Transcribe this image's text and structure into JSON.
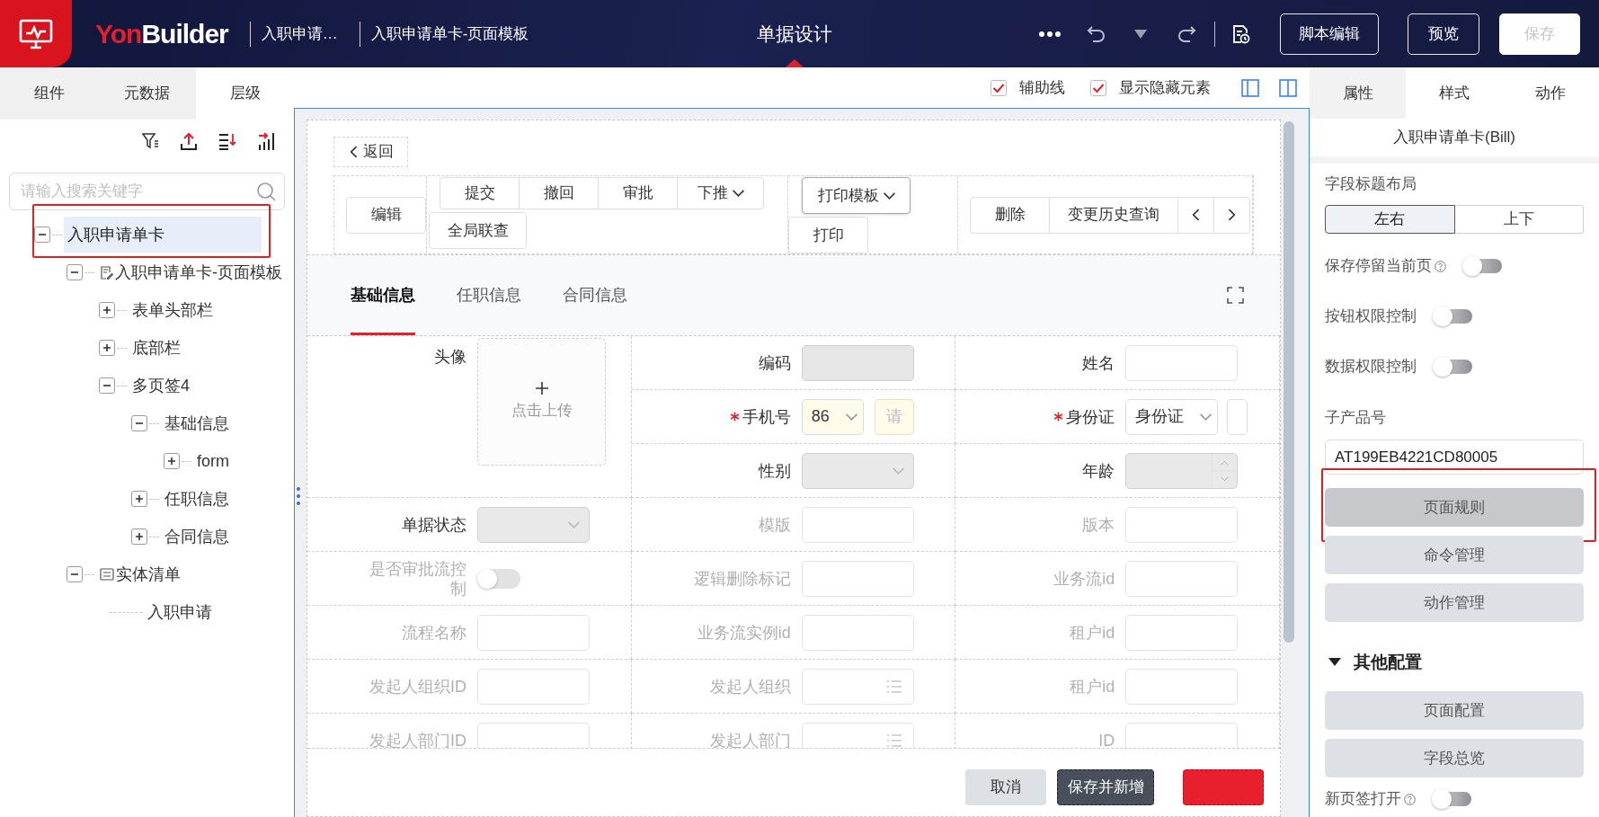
{
  "header": {
    "logo": {
      "accent": "Yon",
      "rest": "Builder"
    },
    "breadcrumbs": [
      "入职申请…",
      "入职申请单卡-页面模板"
    ],
    "title": "单据设计",
    "buttons": [
      {
        "label": "脚本编辑",
        "disabled": false
      },
      {
        "label": "预览",
        "disabled": false
      },
      {
        "label": "保存",
        "disabled": true
      }
    ]
  },
  "left_panel": {
    "tabs": [
      {
        "label": "组件",
        "selected": false
      },
      {
        "label": "元数据",
        "selected": false
      },
      {
        "label": "层级",
        "selected": true
      }
    ],
    "search": {
      "placeholder": "请输入搜索关键字"
    },
    "tree": [
      {
        "label": "入职申请单卡",
        "selected": true,
        "highlighted": true,
        "expanded": true,
        "children": [
          {
            "label": "入职申请单卡-页面模板",
            "kind": "template",
            "selected": false,
            "highlighted": false,
            "expanded": true,
            "children": [
              {
                "label": "表单头部栏",
                "selected": false,
                "highlighted": false,
                "expanded": false
              },
              {
                "label": "底部栏",
                "selected": false,
                "highlighted": false,
                "expanded": false
              },
              {
                "label": "多页签4",
                "selected": false,
                "highlighted": false,
                "expanded": true,
                "children": [
                  {
                    "label": "基础信息",
                    "selected": false,
                    "highlighted": false,
                    "expanded": true,
                    "children": [
                      {
                        "label": "form",
                        "selected": false,
                        "highlighted": false,
                        "expanded": false
                      }
                    ]
                  },
                  {
                    "label": "任职信息",
                    "selected": false,
                    "highlighted": false,
                    "expanded": false
                  },
                  {
                    "label": "合同信息",
                    "selected": false,
                    "highlighted": false,
                    "expanded": false
                  }
                ]
              }
            ]
          },
          {
            "label": "实体清单",
            "kind": "entity",
            "selected": false,
            "highlighted": false,
            "expanded": true,
            "children": [
              {
                "label": "入职申请",
                "selected": false,
                "highlighted": false
              }
            ]
          }
        ]
      }
    ]
  },
  "canvas_options": [
    {
      "label": "辅助线",
      "checked": true
    },
    {
      "label": "显示隐藏元素",
      "checked": true
    }
  ],
  "form": {
    "back_button": "返回",
    "toolbar_groups": [
      [
        [
          {
            "label": "编辑"
          }
        ]
      ],
      [
        [
          {
            "label": "提交"
          },
          {
            "label": "撤回"
          },
          {
            "label": "审批"
          },
          {
            "label": "下推",
            "kind": "dropdown"
          }
        ],
        [
          {
            "label": "全局联查"
          }
        ]
      ],
      [
        [
          {
            "label": "打印模板",
            "kind": "dropdown"
          }
        ],
        [
          {
            "label": "打印"
          }
        ]
      ],
      [
        [
          {
            "label": "删除"
          },
          {
            "label": "变更历史查询"
          },
          {
            "kind": "prev"
          },
          {
            "kind": "next"
          }
        ]
      ]
    ],
    "tabs": [
      {
        "label": "基础信息",
        "selected": true
      },
      {
        "label": "任职信息",
        "selected": false
      },
      {
        "label": "合同信息",
        "selected": false
      }
    ],
    "fields": [
      {
        "label": "头像",
        "kind": "upload",
        "required": false,
        "muted": false,
        "upload_text": "点击上传"
      },
      {
        "label": "编码",
        "kind": "text",
        "required": false,
        "muted": false,
        "readonly": true
      },
      {
        "label": "姓名",
        "kind": "text",
        "required": false,
        "muted": false,
        "readonly": false
      },
      {
        "label": "手机号",
        "kind": "phone",
        "required": true,
        "muted": false,
        "code": "86",
        "placeholder": "请"
      },
      {
        "label": "身份证",
        "kind": "idtype",
        "required": true,
        "muted": false,
        "value": "身份证"
      },
      {
        "label": "性别",
        "kind": "select",
        "required": false,
        "muted": false,
        "readonly": true
      },
      {
        "label": "年龄",
        "kind": "number",
        "required": false,
        "muted": false,
        "readonly": true
      },
      {
        "label": "单据状态",
        "kind": "select",
        "required": false,
        "muted": false,
        "readonly": true
      },
      {
        "label": "模版",
        "kind": "text",
        "required": false,
        "muted": true,
        "readonly": false
      },
      {
        "label": "版本",
        "kind": "text",
        "required": false,
        "muted": true,
        "readonly": false
      },
      {
        "label": "是否审批流控制",
        "kind": "switch",
        "required": false,
        "muted": true,
        "on": false
      },
      {
        "label": "逻辑删除标记",
        "kind": "text",
        "required": false,
        "muted": true,
        "readonly": false
      },
      {
        "label": "业务流id",
        "kind": "text",
        "required": false,
        "muted": true,
        "readonly": false
      },
      {
        "label": "流程名称",
        "kind": "text",
        "required": false,
        "muted": true,
        "readonly": false
      },
      {
        "label": "业务流实例id",
        "kind": "text",
        "required": false,
        "muted": true,
        "readonly": false
      },
      {
        "label": "租户id",
        "kind": "text",
        "required": false,
        "muted": true,
        "readonly": false
      },
      {
        "label": "发起人组织ID",
        "kind": "text",
        "required": false,
        "muted": true,
        "readonly": false
      },
      {
        "label": "发起人组织",
        "kind": "ref",
        "required": false,
        "muted": true,
        "readonly": false
      },
      {
        "label": "租户id",
        "kind": "text",
        "required": false,
        "muted": true,
        "readonly": false
      },
      {
        "label": "发起人部门ID",
        "kind": "text",
        "required": false,
        "muted": true,
        "readonly": false
      },
      {
        "label": "发起人部门",
        "kind": "ref",
        "required": false,
        "muted": true,
        "readonly": false
      },
      {
        "label": "ID",
        "kind": "text",
        "required": false,
        "muted": true,
        "readonly": false
      }
    ],
    "footer_buttons": [
      {
        "label": "取消",
        "kind": "secondary"
      },
      {
        "label": "保存并新增",
        "kind": "dark"
      },
      {
        "kind": "danger"
      }
    ]
  },
  "right_panel": {
    "tabs": [
      {
        "label": "属性",
        "selected": true
      },
      {
        "label": "样式",
        "selected": false
      },
      {
        "label": "动作",
        "selected": false
      }
    ],
    "title": "入职申请单卡(Bill)",
    "layout_label": "字段标题布局",
    "layout_options": [
      {
        "label": "左右",
        "selected": true
      },
      {
        "label": "上下",
        "selected": false
      }
    ],
    "toggles": [
      {
        "label": "保存停留当前页",
        "help": true,
        "on": false
      },
      {
        "label": "按钮权限控制",
        "help": false,
        "on": false
      },
      {
        "label": "数据权限控制",
        "help": false,
        "on": false
      }
    ],
    "sub_product": {
      "label": "子产品号",
      "value": "AT199EB4221CD80005"
    },
    "buttons": [
      {
        "label": "页面规则",
        "highlighted": true
      },
      {
        "label": "命令管理",
        "highlighted": false
      },
      {
        "label": "动作管理",
        "highlighted": false
      }
    ],
    "section": {
      "title": "其他配置",
      "expanded": true,
      "buttons": [
        {
          "label": "页面配置",
          "highlighted": false
        },
        {
          "label": "字段总览",
          "highlighted": false
        }
      ],
      "toggles": [
        {
          "label": "新页签打开",
          "help": true,
          "on": false
        }
      ]
    }
  }
}
